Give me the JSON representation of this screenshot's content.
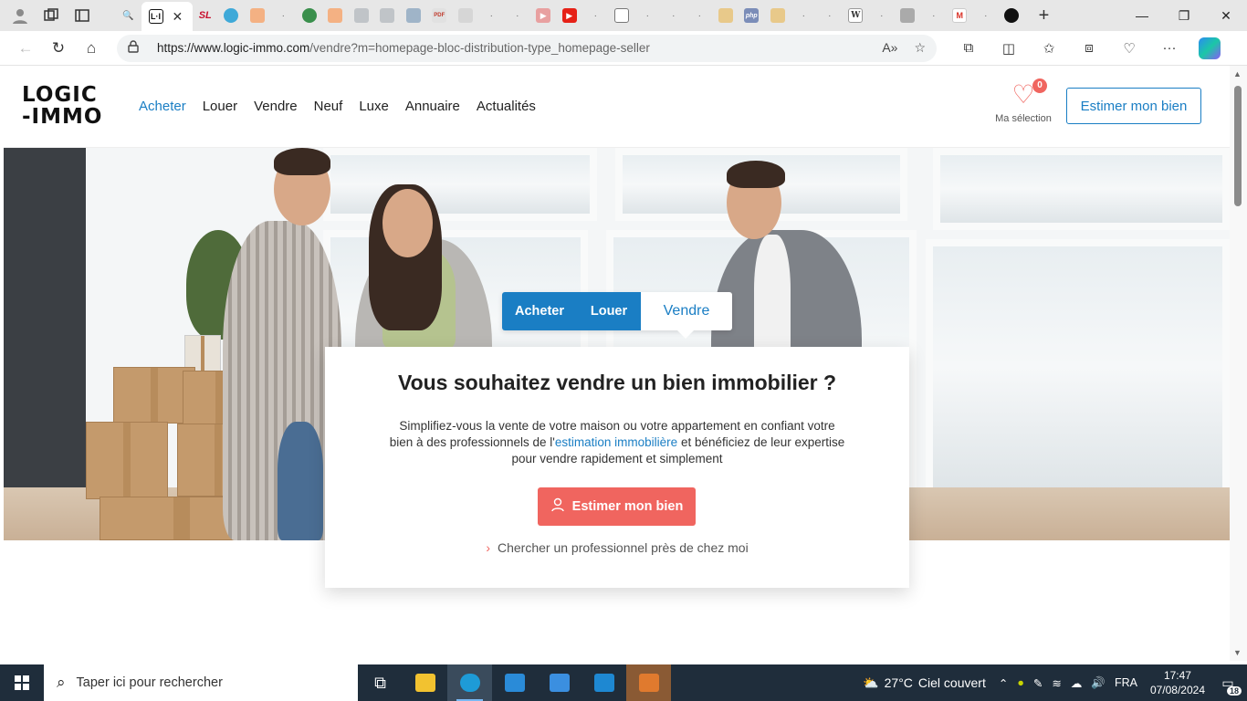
{
  "browser": {
    "url_domain": "https://www.logic-immo.com",
    "url_path": "/vendre?m=homepage-bloc-distribution-type_homepage-seller",
    "active_tab_favicon": "L·I",
    "tab_favicons": [
      "SL",
      "PDF",
      "php",
      "W"
    ]
  },
  "site": {
    "logo_line1": "LOGIC",
    "logo_line2": "-IMMO",
    "nav": [
      {
        "label": "Acheter",
        "active": true
      },
      {
        "label": "Louer",
        "active": false
      },
      {
        "label": "Vendre",
        "active": false
      },
      {
        "label": "Neuf",
        "active": false
      },
      {
        "label": "Luxe",
        "active": false
      },
      {
        "label": "Annuaire",
        "active": false
      },
      {
        "label": "Actualités",
        "active": false
      }
    ],
    "selection_count": "0",
    "selection_label": "Ma sélection",
    "estimate_button": "Estimer mon bien"
  },
  "search_tabs": {
    "buy": "Acheter",
    "rent": "Louer",
    "sell": "Vendre"
  },
  "card": {
    "title": "Vous souhaitez vendre un bien immobilier ?",
    "text_before_link": "Simplifiez-vous la vente de votre maison ou votre appartement en confiant votre bien à des professionnels de l'",
    "link_text": "estimation immobilière",
    "text_after_link": " et bénéficiez de leur expertise pour vendre rapidement et simplement",
    "cta_label": "Estimer mon bien",
    "pro_link": "Chercher un professionnel près de chez moi"
  },
  "taskbar": {
    "search_placeholder": "Taper ici pour rechercher",
    "temperature": "27°C",
    "weather": "Ciel couvert",
    "language": "FRA",
    "time": "17:47",
    "date": "07/08/2024",
    "notifications": "18"
  },
  "colors": {
    "brand_blue": "#1a7ec4",
    "brand_coral": "#f0655f",
    "taskbar": "#1f2d3b"
  }
}
